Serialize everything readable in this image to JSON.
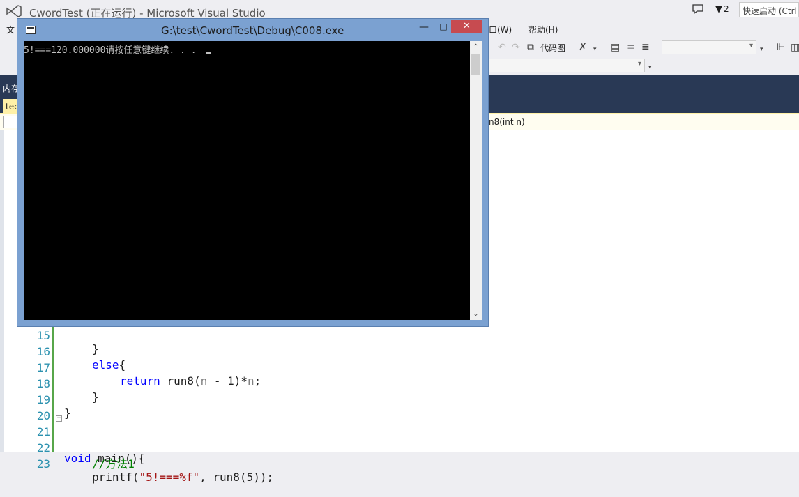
{
  "vs": {
    "title": "CwordTest (正在运行) - Microsoft Visual Studio",
    "filter_count": "2",
    "quick_launch_placeholder": "快速启动 (Ctrl+Q)"
  },
  "menu": {
    "file_partial": "文",
    "window_partial": "口(W)",
    "help": "帮助(H)"
  },
  "toolbar": {
    "codemap_label": "代码图"
  },
  "tabs": {
    "left_a": "内存",
    "left_b": "tec"
  },
  "nav": {
    "function": "n8(int n)"
  },
  "console": {
    "title": "G:\\test\\CwordTest\\Debug\\C008.exe",
    "output": "5!===120.000000请按任意键继续. . . ",
    "close": "✕",
    "minimize": "—",
    "maximize": "□"
  },
  "code": {
    "lines": [
      {
        "n": "15",
        "text": "}"
      },
      {
        "n": "16",
        "kw": "else",
        "rest": "{"
      },
      {
        "n": "17",
        "kw": "return",
        "fn": " run8(",
        "p1": "n",
        "mid": " - 1)*",
        "p2": "n",
        "end": ";"
      },
      {
        "n": "18",
        "text": "}"
      },
      {
        "n": "19",
        "text": "}"
      },
      {
        "n": "20",
        "text": ""
      },
      {
        "n": "21",
        "kw": "void",
        "rest": " main(){"
      },
      {
        "n": "22",
        "comment": "//方法1"
      },
      {
        "n": "23",
        "fn": "printf(",
        "str": "\"5!===%f\"",
        "rest": ", run8(5));"
      }
    ]
  }
}
